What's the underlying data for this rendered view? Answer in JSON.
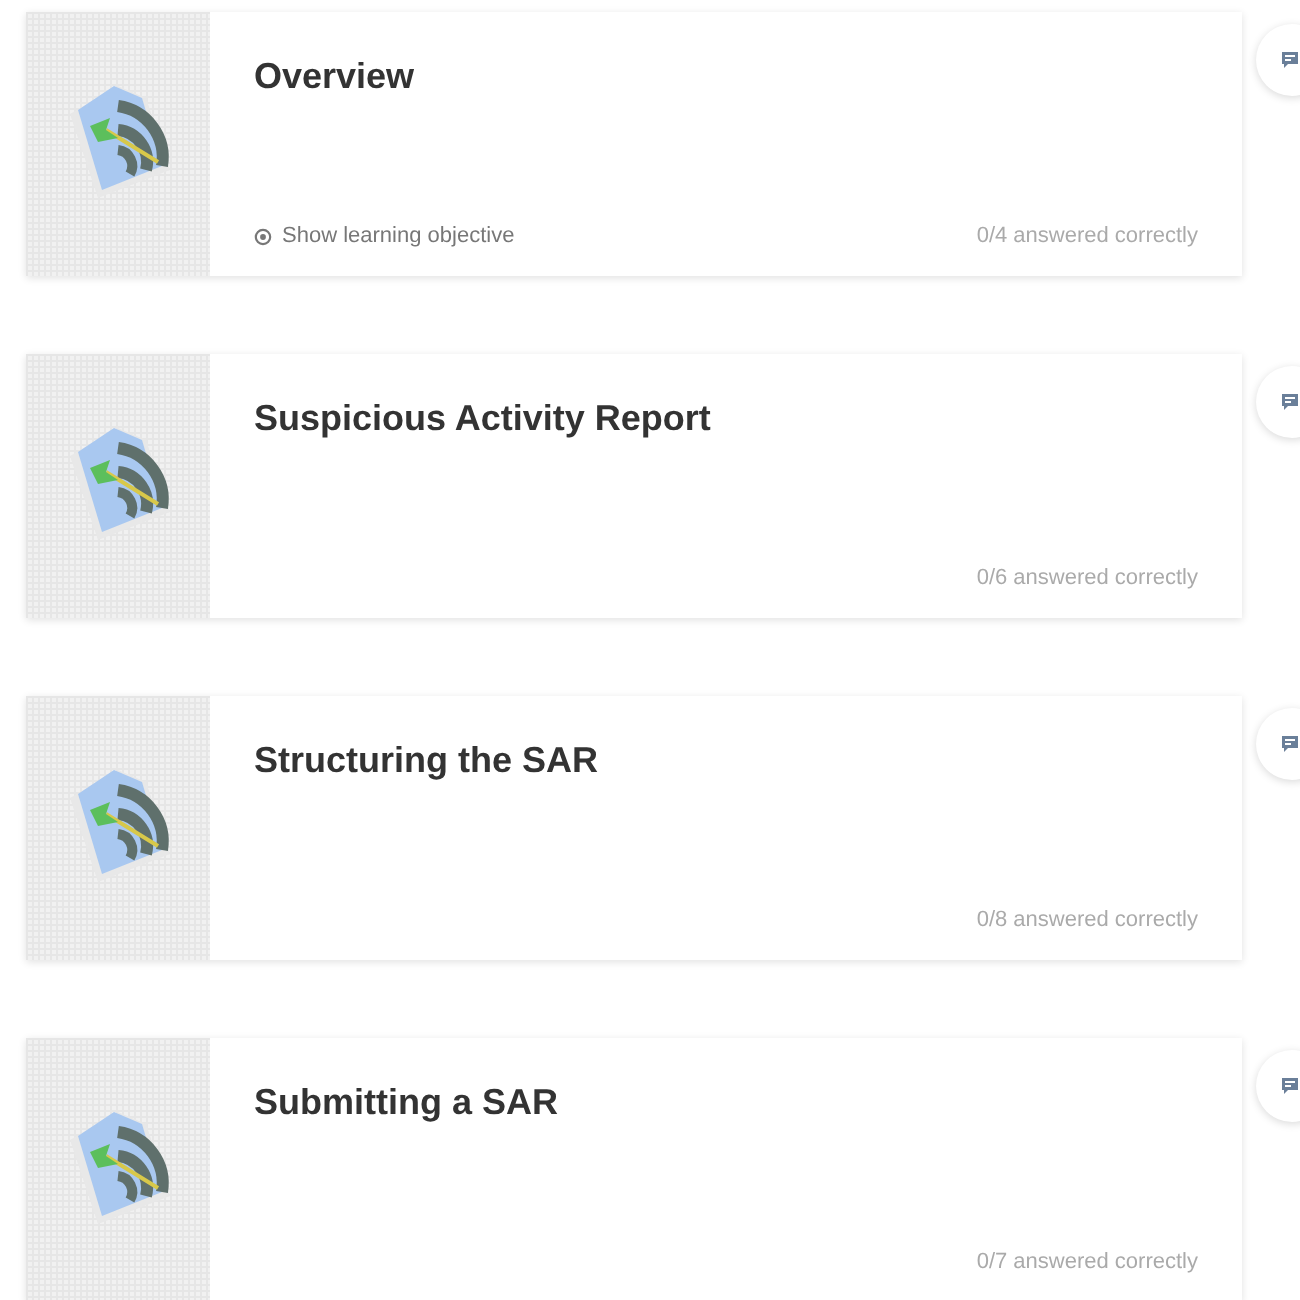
{
  "lessons": [
    {
      "title": "Overview",
      "objective_link": "Show learning objective",
      "score": "0/4 answered correctly"
    },
    {
      "title": "Suspicious Activity Report",
      "score": "0/6 answered correctly"
    },
    {
      "title": "Structuring the SAR",
      "score": "0/8 answered correctly"
    },
    {
      "title": "Submitting a SAR",
      "score": "0/7 answered correctly"
    }
  ]
}
